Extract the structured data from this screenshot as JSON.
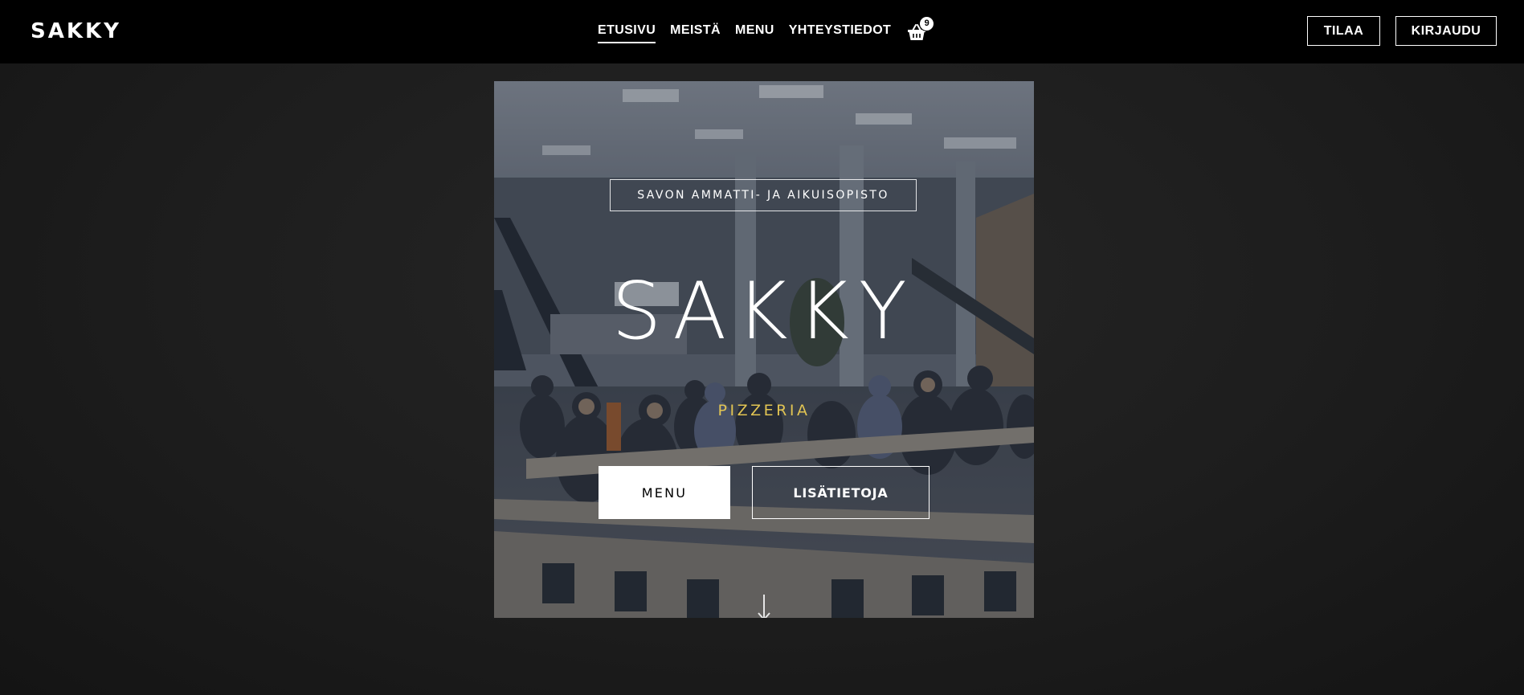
{
  "header": {
    "brand": "SAKKY",
    "nav": [
      {
        "label": "ETUSIVU",
        "active": true
      },
      {
        "label": "MEISTÄ",
        "active": false
      },
      {
        "label": "MENU",
        "active": false
      },
      {
        "label": "YHTEYSTIEDOT",
        "active": false
      }
    ],
    "cart": {
      "icon": "basket-icon",
      "count": "9"
    },
    "order_label": "TILAA",
    "login_label": "KIRJAUDU"
  },
  "hero": {
    "tagline": "SAVON AMMATTI- JA AIKUISOPISTO",
    "title": "SAKKY",
    "subtitle": "PIZZERIA",
    "menu_button": "MENU",
    "info_button": "LISÄTIETOJA",
    "scroll_icon": "arrow-down-icon",
    "background": "photo of a school cafeteria with students seated at long tables"
  },
  "colors": {
    "header_bg": "#000000",
    "page_bg": "#1c1c1c",
    "accent": "#e1c453",
    "text": "#ffffff"
  }
}
